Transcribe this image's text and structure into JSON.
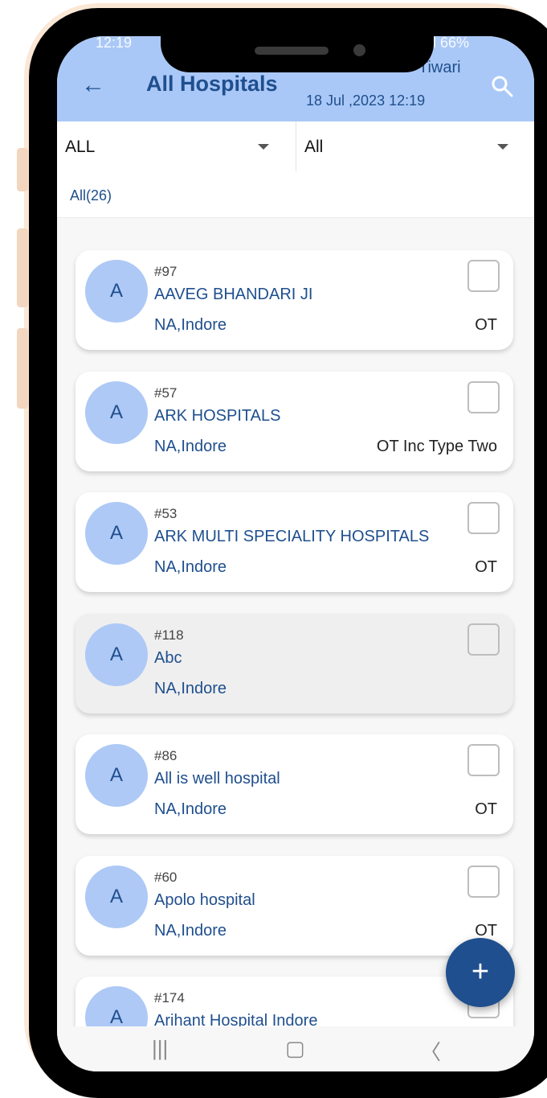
{
  "status": {
    "time": "12:19",
    "right": "ill 66%"
  },
  "appbar": {
    "title": "All Hospitals",
    "username": "Tiwari",
    "datetime": "18 Jul ,2023 12:19"
  },
  "filters": {
    "left": "ALL",
    "right": "All"
  },
  "tab": {
    "label": "All(26)"
  },
  "hospitals": [
    {
      "avatar": "A",
      "id": "#97",
      "name": "AAVEG BHANDARI JI",
      "location": "NA,Indore",
      "type": "OT"
    },
    {
      "avatar": "A",
      "id": "#57",
      "name": "ARK HOSPITALS",
      "location": "NA,Indore",
      "type": "OT Inc Type Two"
    },
    {
      "avatar": "A",
      "id": "#53",
      "name": "ARK MULTI SPECIALITY HOSPITALS",
      "location": "NA,Indore",
      "type": "OT"
    },
    {
      "avatar": "A",
      "id": "#118",
      "name": "Abc",
      "location": "NA,Indore",
      "type": ""
    },
    {
      "avatar": "A",
      "id": "#86",
      "name": "All is well hospital",
      "location": "NA,Indore",
      "type": "OT"
    },
    {
      "avatar": "A",
      "id": "#60",
      "name": "Apolo hospital",
      "location": "NA,Indore",
      "type": "OT"
    },
    {
      "avatar": "A",
      "id": "#174",
      "name": "Arihant Hospital Indore",
      "location": "",
      "type": ""
    }
  ],
  "fab": {
    "label": "+"
  },
  "navbar": {
    "recent": "|||",
    "home": "▢",
    "back": "〈"
  },
  "colors": {
    "accent": "#1f4f8e",
    "appbar": "#aac8f7",
    "avatar": "#aec9f6"
  }
}
